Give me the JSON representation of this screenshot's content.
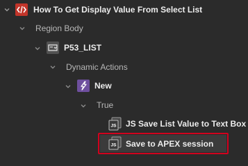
{
  "tree": {
    "page_title": "How To Get Display Value From Select List",
    "region_body": "Region Body",
    "item": "P53_LIST",
    "dynamic_actions": "Dynamic Actions",
    "da_new": "New",
    "true_branch": "True",
    "action_1": "JS Save List Value to Text Box",
    "action_2": "Save to APEX session"
  },
  "colors": {
    "background": "#2b2b2b",
    "selected_bg": "#3b3b3b",
    "selection_border": "#d1001d",
    "code_icon_bg": "#c2352a",
    "da_icon_bg": "#6e4f9e"
  },
  "icons": {
    "page": "code-brackets-icon",
    "item": "select-list-icon",
    "dynamic_action": "lightning-icon",
    "js_action": "javascript-file-icon"
  }
}
